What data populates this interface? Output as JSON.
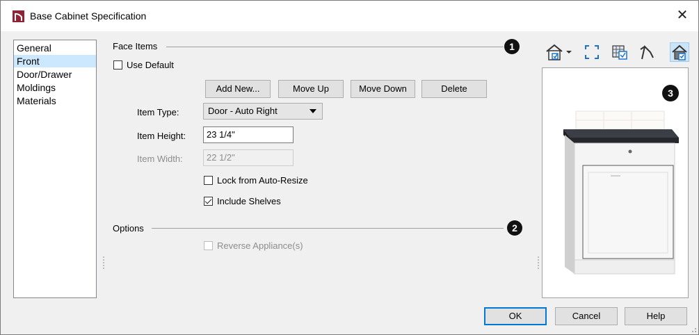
{
  "window": {
    "title": "Base Cabinet Specification",
    "app_icon": "chief-architect-icon",
    "close_glyph": "✕"
  },
  "nav": {
    "items": [
      {
        "label": "General",
        "selected": false
      },
      {
        "label": "Front",
        "selected": true
      },
      {
        "label": "Door/Drawer",
        "selected": false
      },
      {
        "label": "Moldings",
        "selected": false
      },
      {
        "label": "Materials",
        "selected": false
      }
    ]
  },
  "face_items": {
    "heading": "Face Items",
    "badge": "1",
    "use_default": {
      "label": "Use Default",
      "checked": false
    },
    "buttons": {
      "add_new": "Add New...",
      "move_up": "Move Up",
      "move_down": "Move Down",
      "delete": "Delete"
    },
    "item_type": {
      "label": "Item Type:",
      "value": "Door - Auto Right"
    },
    "item_height": {
      "label": "Item Height:",
      "value": "23 1/4\""
    },
    "item_width": {
      "label": "Item Width:",
      "value": "22 1/2\""
    },
    "lock_auto_resize": {
      "label": "Lock from Auto-Resize",
      "checked": false
    },
    "include_shelves": {
      "label": "Include Shelves",
      "checked": true
    }
  },
  "options": {
    "heading": "Options",
    "badge": "2",
    "reverse_appliance": {
      "label": "Reverse Appliance(s)",
      "checked": false,
      "disabled": true
    }
  },
  "preview": {
    "badge": "3"
  },
  "toolbar": {
    "icons": [
      "house-view-dropdown-icon",
      "fill-window-icon",
      "show-checked-icon",
      "toggle-lines-icon",
      "color-on-icon"
    ]
  },
  "footer": {
    "ok": "OK",
    "cancel": "Cancel",
    "help": "Help"
  },
  "colors": {
    "selected_nav": "#cce8ff",
    "countertop": "#2b2d33",
    "badge": "#111111",
    "accent": "#0078d7"
  }
}
